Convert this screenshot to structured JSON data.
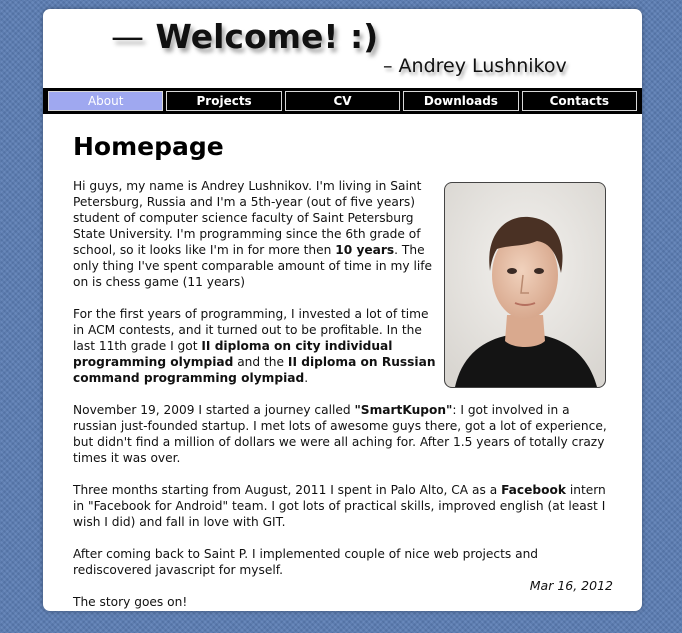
{
  "header": {
    "dash": "—",
    "title": "Welcome! :)",
    "author": "– Andrey Lushnikov"
  },
  "nav": {
    "items": [
      "About",
      "Projects",
      "CV",
      "Downloads",
      "Contacts"
    ],
    "active": "About"
  },
  "main": {
    "heading": "Homepage",
    "p1": {
      "a": "Hi guys, my name is Andrey Lushnikov. I'm living in Saint Petersburg, Russia and I'm a 5th-year (out of five years) student of computer science faculty of Saint Petersburg State University. I'm programming since the 6th grade of school, so it looks like I'm in for more then ",
      "b": "10 years",
      "c": ". The only thing I've spent comparable amount of time in my life on is chess game (11 years)"
    },
    "p2": {
      "a": "For the first years of programming, I invested a lot of time in ACM contests, and it turned out to be profitable. In the last 11th grade I got ",
      "b": "II diploma on city individual programming olympiad",
      "c": " and the ",
      "d": "II diploma on Russian command programming olympiad",
      "e": "."
    },
    "p3": {
      "a": "November 19, 2009 I started a journey called ",
      "b": "\"SmartKupon\"",
      "c": ": I got involved in a russian just-founded startup. I met lots of awesome guys there, got a lot of experience, but didn't find a million of dollars we were all aching for. After 1.5 years of totally crazy times it was over."
    },
    "p4": {
      "a": "Three months starting from August, 2011 I spent in Palo Alto, CA as a ",
      "b": "Facebook",
      "c": " intern in \"Facebook for Android\" team. I got lots of practical skills, improved english (at least I wish I did) and fall in love with GIT."
    },
    "p5": "After coming back to Saint P. I implemented couple of nice web projects and rediscovered javascript for myself.",
    "p6": "The story goes on!",
    "date": "Mar 16, 2012"
  },
  "colors": {
    "background": "#5b7db4",
    "nav_bar": "#000000",
    "nav_active": "#9fa8f0"
  }
}
